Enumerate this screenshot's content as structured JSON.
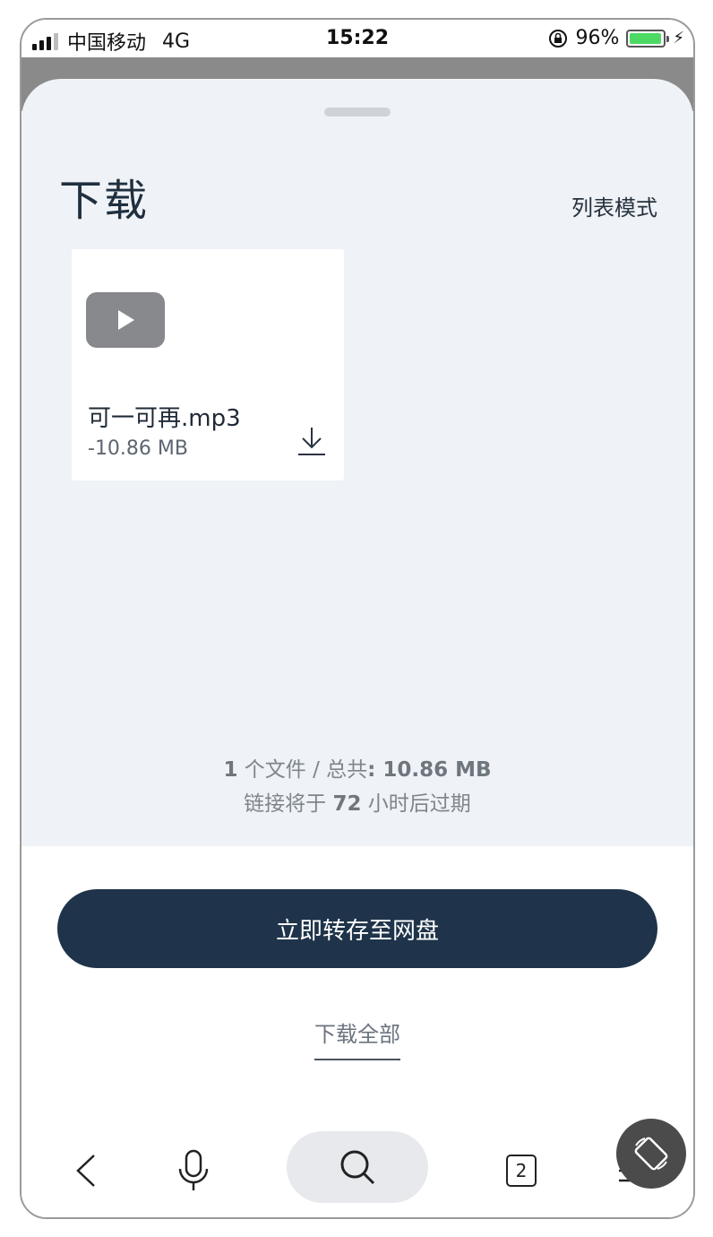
{
  "status_bar": {
    "carrier": "中国移动",
    "network": "4G",
    "time": "15:22",
    "battery": "96%",
    "battery_level": 0.96,
    "battery_color": "#4cd964"
  },
  "page": {
    "title": "下载",
    "list_mode": "列表模式"
  },
  "files": [
    {
      "name": "可一可再.mp3",
      "size": "-10.86 MB",
      "thumb_icon": "play-icon",
      "action_icon": "download-icon"
    }
  ],
  "summary": {
    "count": "1",
    "count_suffix": " 个文件 / 总共",
    "total": ": 10.86 MB",
    "expiry_prefix": "链接将于 ",
    "expiry_hours": "72",
    "expiry_suffix": " 小时后过期"
  },
  "actions": {
    "save_to_drive": "立即转存至网盘",
    "download_all": "下载全部"
  },
  "browser_bar": {
    "tab_count": "2",
    "icons": [
      "back-icon",
      "microphone-icon",
      "search-icon",
      "tabs-icon",
      "menu-icon",
      "rotate-icon"
    ]
  },
  "colors": {
    "accent_button": "#1f344a",
    "sheet_background": "#eff2f6"
  }
}
